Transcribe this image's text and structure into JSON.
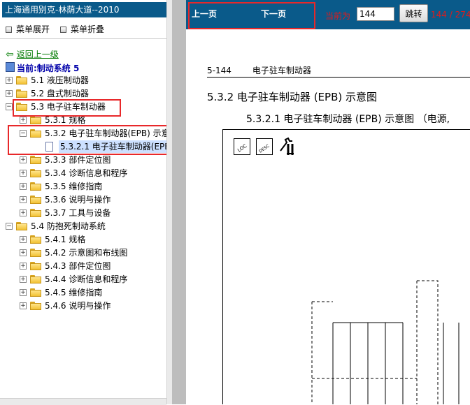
{
  "app": {
    "title": "上海通用别克-林荫大道--2010"
  },
  "menu": {
    "expand_label": "菜单展开",
    "collapse_label": "菜单折叠"
  },
  "nav": {
    "back_label": "返回上一级",
    "current_label": "当前:制动系统 5"
  },
  "tree": [
    {
      "label": "5.1 液压制动器",
      "level": 0,
      "expander": "+",
      "icon": "folder"
    },
    {
      "label": "5.2 盘式制动器",
      "level": 0,
      "expander": "+",
      "icon": "folder"
    },
    {
      "label": "5.3 电子驻车制动器",
      "level": 0,
      "expander": "-",
      "icon": "folder-open"
    },
    {
      "label": "5.3.1 规格",
      "level": 1,
      "expander": "+",
      "icon": "folder"
    },
    {
      "label": "5.3.2 电子驻车制动器(EPB) 示意",
      "level": 1,
      "expander": "-",
      "icon": "folder-open"
    },
    {
      "label": "5.3.2.1 电子驻车制动器(EPB",
      "level": 2,
      "expander": "",
      "icon": "doc",
      "selected": true
    },
    {
      "label": "5.3.3 部件定位图",
      "level": 1,
      "expander": "+",
      "icon": "folder"
    },
    {
      "label": "5.3.4 诊断信息和程序",
      "level": 1,
      "expander": "+",
      "icon": "folder"
    },
    {
      "label": "5.3.5 维修指南",
      "level": 1,
      "expander": "+",
      "icon": "folder"
    },
    {
      "label": "5.3.6 说明与操作",
      "level": 1,
      "expander": "+",
      "icon": "folder"
    },
    {
      "label": "5.3.7 工具与设备",
      "level": 1,
      "expander": "+",
      "icon": "folder"
    },
    {
      "label": "5.4 防抱死制动系统",
      "level": 0,
      "expander": "-",
      "icon": "folder-open"
    },
    {
      "label": "5.4.1 规格",
      "level": 1,
      "expander": "+",
      "icon": "folder"
    },
    {
      "label": "5.4.2 示意图和布线图",
      "level": 1,
      "expander": "+",
      "icon": "folder"
    },
    {
      "label": "5.4.3 部件定位图",
      "level": 1,
      "expander": "+",
      "icon": "folder"
    },
    {
      "label": "5.4.4 诊断信息和程序",
      "level": 1,
      "expander": "+",
      "icon": "folder"
    },
    {
      "label": "5.4.5 维修指南",
      "level": 1,
      "expander": "+",
      "icon": "folder"
    },
    {
      "label": "5.4.6 说明与操作",
      "level": 1,
      "expander": "+",
      "icon": "folder"
    }
  ],
  "toolbar": {
    "prev_label": "上一页",
    "next_label": "下一页",
    "current_label": "当前为",
    "page_value": "144",
    "go_label": "跳转",
    "page_indicator": "144 / 274"
  },
  "document": {
    "header_left": "5-144",
    "header_right": "电子驻车制动器",
    "section_title": "5.3.2 电子驻车制动器 (EPB) 示意图",
    "subsection_title": "5.3.2.1 电子驻车制动器 (EPB) 示意图 （电源,",
    "icon_names": [
      "loc-icon",
      "desc-icon",
      "wrench-icon"
    ]
  },
  "colors": {
    "title_bar": "#0a5a8a",
    "accent_red": "#e01b1b",
    "link_green": "#007a00",
    "current_blue": "#0000aa",
    "selection": "#cce0ff"
  }
}
